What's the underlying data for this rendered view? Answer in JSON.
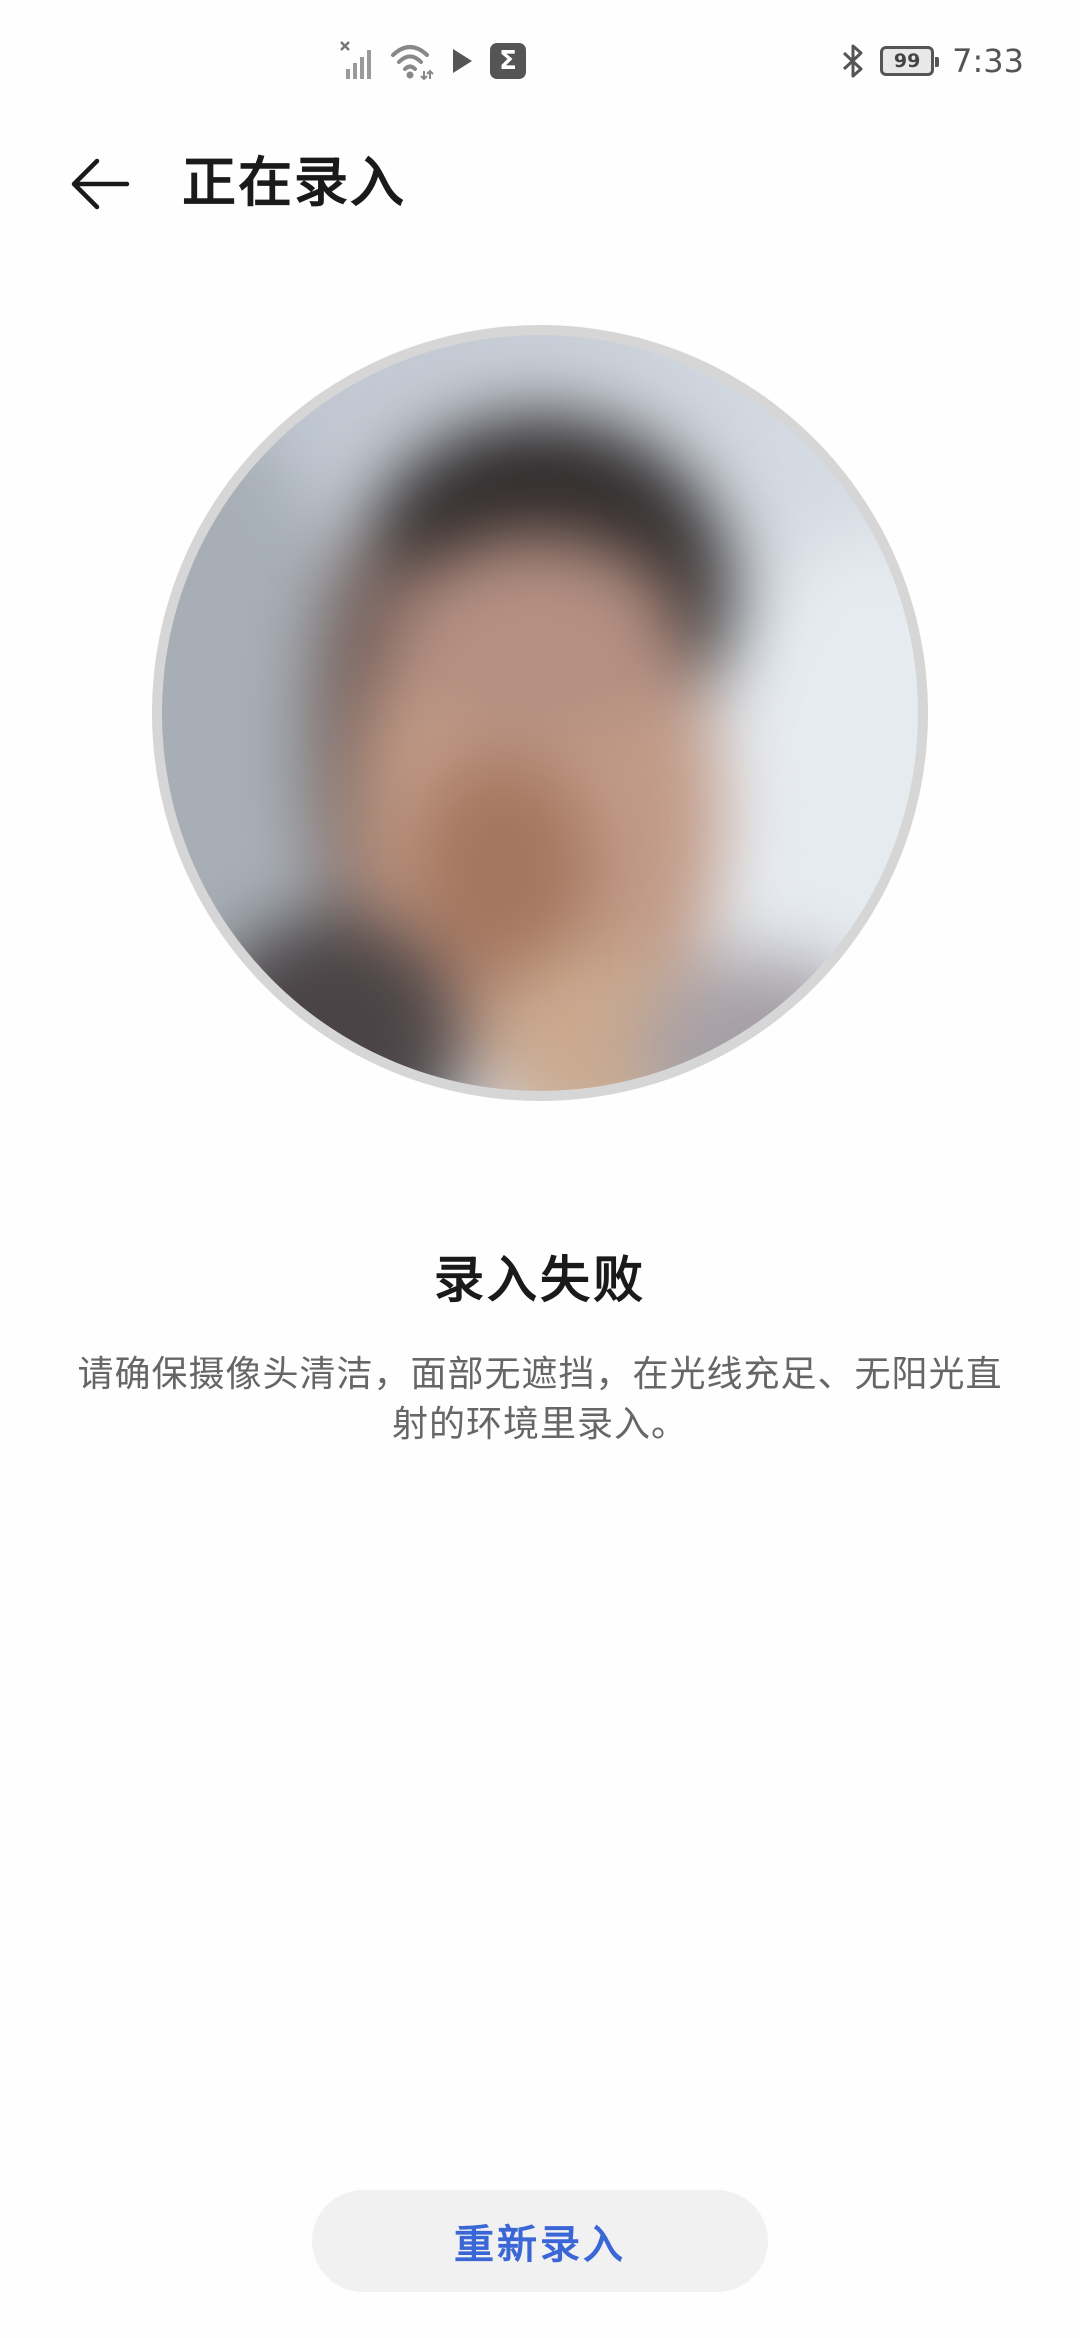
{
  "status_bar": {
    "icons": [
      "no-signal-icon",
      "wifi-icon",
      "play-icon",
      "sigma-icon",
      "bluetooth-icon"
    ],
    "sigma_glyph": "Σ",
    "battery_level": "99",
    "time": "7:33"
  },
  "header": {
    "back_icon": "arrow-left-icon",
    "title": "正在录入"
  },
  "face_preview": {
    "description_icon": "face-camera-preview"
  },
  "result": {
    "title": "录入失败",
    "description": "请确保摄像头清洁，面部无遮挡，在光线充足、无阳光直射的环境里录入。"
  },
  "actions": {
    "retry_label": "重新录入"
  },
  "colors": {
    "accent": "#3a66d6",
    "title_text": "#1a1a1a",
    "secondary_text": "#666666",
    "button_bg": "#f1f1f1"
  }
}
